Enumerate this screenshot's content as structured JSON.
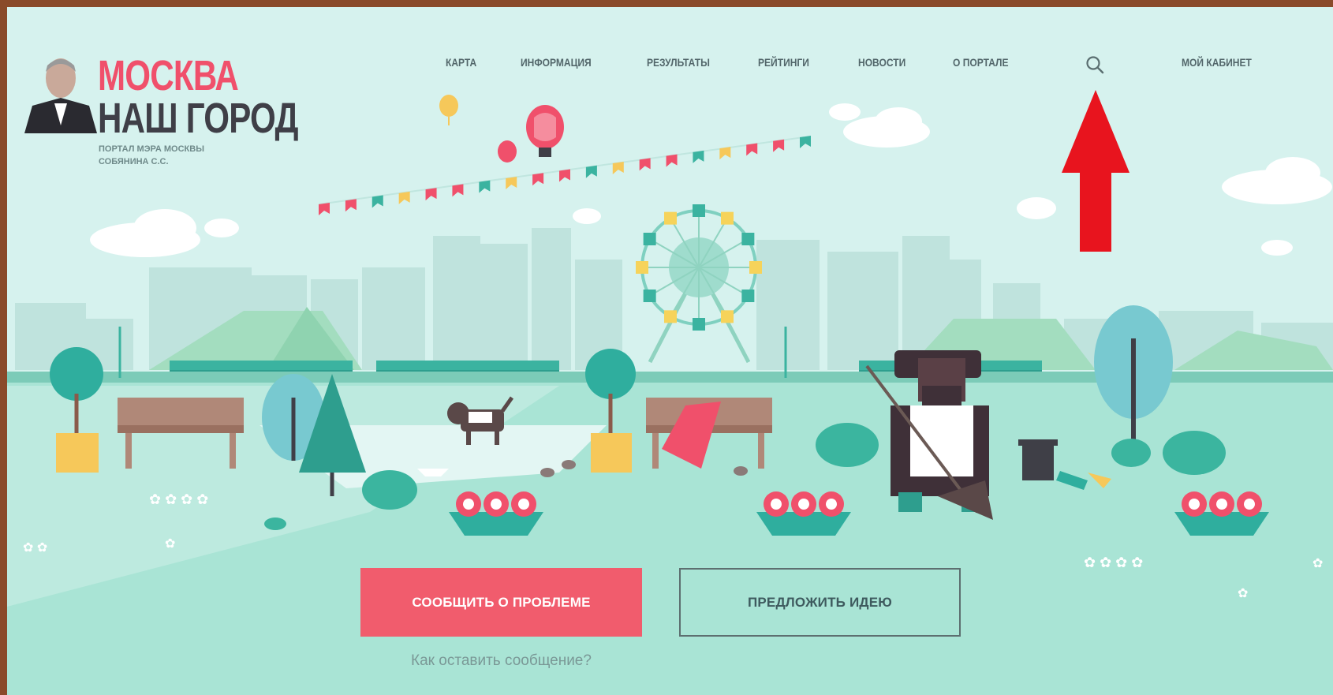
{
  "header": {
    "logo": {
      "title_line1": "МОСКВА",
      "title_line2": "НАШ ГОРОД",
      "subtitle_line1": "ПОРТАЛ МЭРА МОСКВЫ",
      "subtitle_line2": "СОБЯНИНА С.С."
    },
    "nav": [
      {
        "label": "КАРТА"
      },
      {
        "label": "ИНФОРМАЦИЯ"
      },
      {
        "label": "РЕЗУЛЬТАТЫ"
      },
      {
        "label": "РЕЙТИНГИ"
      },
      {
        "label": "НОВОСТИ"
      },
      {
        "label": "О ПОРТАЛЕ"
      }
    ],
    "search_icon": "search-icon",
    "account_label": "МОЙ КАБИНЕТ"
  },
  "hero": {
    "primary_button": "СООБЩИТЬ О ПРОБЛЕМЕ",
    "secondary_button": "ПРЕДЛОЖИТЬ ИДЕЮ",
    "help_link": "Как оставить сообщение?"
  },
  "annotation": {
    "arrow_color": "#e8141e",
    "arrow_icon": "arrow-up-icon"
  },
  "colors": {
    "brand_red": "#f0506b",
    "brand_dark": "#3f3f47",
    "background": "#d6f2ee",
    "ground": "#a9e4d5"
  }
}
